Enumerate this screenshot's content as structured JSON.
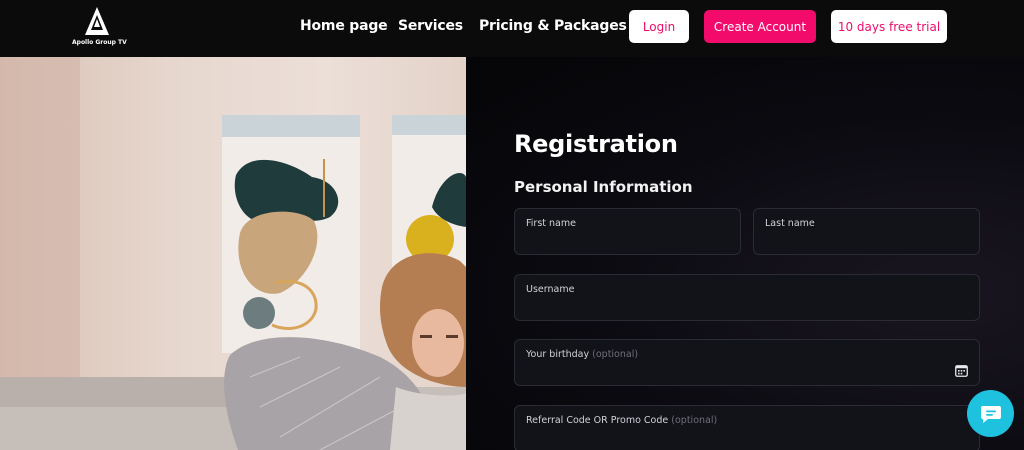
{
  "brand": {
    "name": "Apollo Group TV"
  },
  "nav": {
    "items": [
      {
        "label": "Home page"
      },
      {
        "label": "Services"
      },
      {
        "label": "Pricing & Packages"
      }
    ],
    "login_label": "Login",
    "create_label": "Create Account",
    "trial_label": "10 days free trial"
  },
  "colors": {
    "accent_pink": "#f30b6c",
    "chat_cyan": "#1ec2df",
    "panel_dark": "#0b0a10"
  },
  "form": {
    "title": "Registration",
    "subtitle": "Personal Information",
    "first_name": {
      "label": "First name",
      "value": ""
    },
    "last_name": {
      "label": "Last name",
      "value": ""
    },
    "username": {
      "label": "Username",
      "value": ""
    },
    "birthday": {
      "label": "Your birthday",
      "hint": "(optional)",
      "value": "",
      "icon": "calendar-icon"
    },
    "referral": {
      "label": "Referral Code OR Promo Code",
      "hint": "(optional)",
      "value": ""
    }
  },
  "chat": {
    "icon": "chat-icon"
  }
}
